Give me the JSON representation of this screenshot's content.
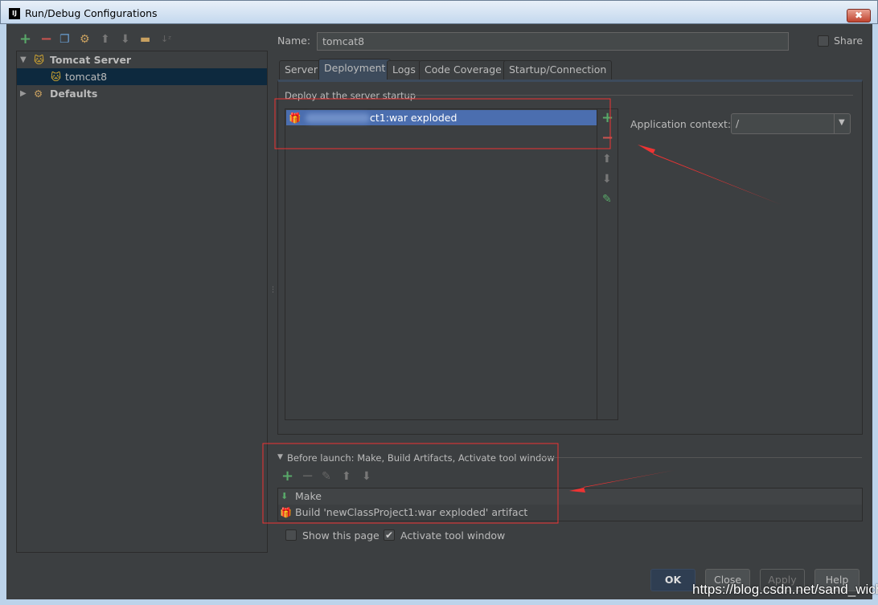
{
  "window": {
    "title": "Run/Debug Configurations",
    "logo": "IJ",
    "close": "✖"
  },
  "toolbar": {
    "icons": [
      "add-icon",
      "remove-icon",
      "copy-icon",
      "wrench-icon",
      "move-up-icon",
      "move-down-icon",
      "folder-icon",
      "sort-icon"
    ]
  },
  "tree": [
    {
      "label": "Tomcat Server",
      "expanded": true,
      "icon": "tomcat-icon"
    },
    {
      "label": "tomcat8",
      "selected": true,
      "icon": "tomcat-icon"
    },
    {
      "label": "Defaults",
      "expanded": false,
      "icon": "wrench-icon"
    }
  ],
  "name": {
    "label": "Name:",
    "value": "tomcat8"
  },
  "share": {
    "label": "Share",
    "checked": false
  },
  "tabs": [
    {
      "label": "Server"
    },
    {
      "label": "Deployment",
      "active": true
    },
    {
      "label": "Logs"
    },
    {
      "label": "Code Coverage"
    },
    {
      "label": "Startup/Connection"
    }
  ],
  "deployment": {
    "section_label": "Deploy at the server startup",
    "items": [
      {
        "label": "ct1:war exploded",
        "selected": true
      }
    ],
    "app_context_label": "Application context:",
    "app_context_value": "/"
  },
  "before_launch": {
    "title": "Before launch: Make, Build Artifacts, Activate tool window",
    "items": [
      {
        "label": "Make"
      },
      {
        "label": "Build 'newClassProject1:war exploded' artifact"
      }
    ]
  },
  "options": {
    "show_page": {
      "label": "Show this page",
      "checked": false
    },
    "activate_tool": {
      "label": "Activate tool window",
      "checked": true
    }
  },
  "buttons": {
    "ok": "OK",
    "close": "Close",
    "apply": "Apply",
    "help": "Help"
  },
  "watermark": "https://blog.csdn.net/sand_wich",
  "colors": {
    "accent_green": "#59a869",
    "accent_red": "#c75450",
    "selection": "#4b6eaf",
    "annotation": "#ee3333"
  }
}
